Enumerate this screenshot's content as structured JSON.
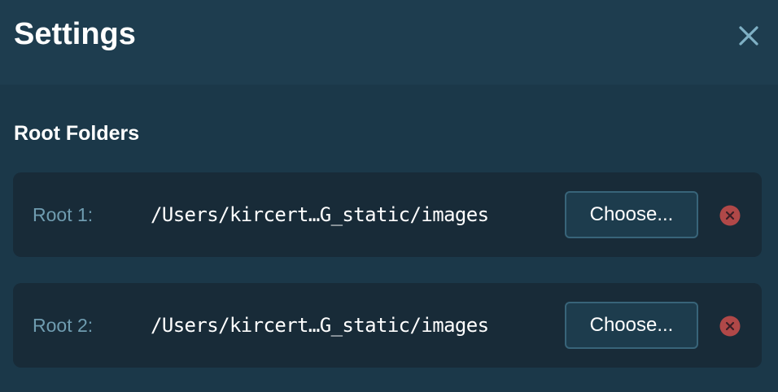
{
  "header": {
    "title": "Settings",
    "close_icon": "close-icon"
  },
  "root_folders": {
    "title": "Root Folders",
    "items": [
      {
        "label": "Root 1:",
        "path": "/Users/kircert…G_static/images",
        "choose_label": "Choose...",
        "remove_icon": "remove-circle-icon"
      },
      {
        "label": "Root 2:",
        "path": "/Users/kircert…G_static/images",
        "choose_label": "Choose...",
        "remove_icon": "remove-circle-icon"
      }
    ]
  },
  "colors": {
    "background": "#1b3849",
    "header_background": "#1e3d4f",
    "row_background": "#182b38",
    "label_text": "#6f9cb0",
    "close_icon": "#7fb0c4",
    "remove_icon": "#b04848"
  }
}
